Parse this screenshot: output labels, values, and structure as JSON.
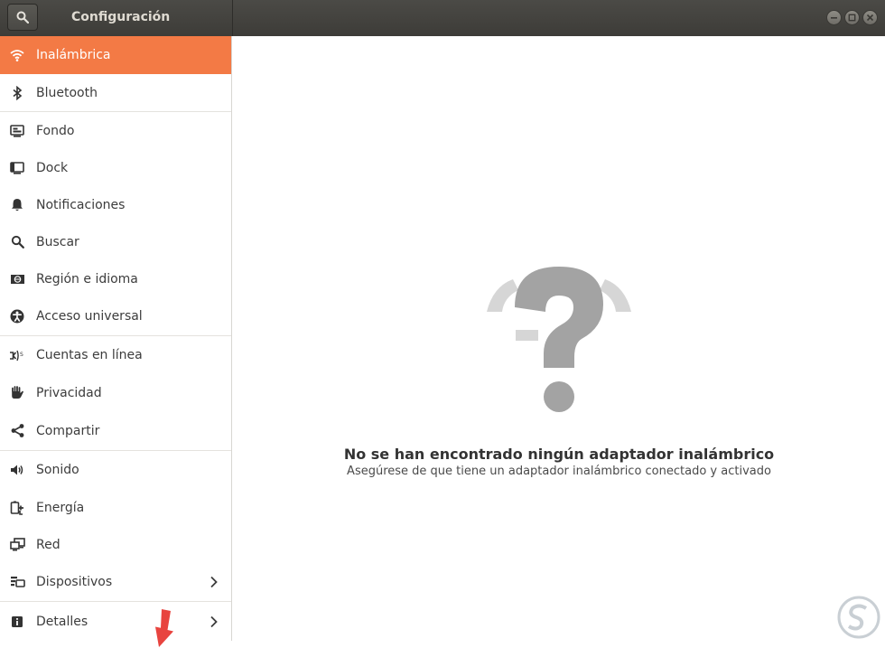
{
  "window": {
    "title": "Configuración"
  },
  "sidebar": {
    "items": [
      {
        "label": "Inalámbrica",
        "icon": "wifi-icon",
        "active": true
      },
      {
        "label": "Bluetooth",
        "icon": "bluetooth-icon"
      },
      {
        "label": "Fondo",
        "icon": "background-icon"
      },
      {
        "label": "Dock",
        "icon": "dock-icon"
      },
      {
        "label": "Notificaciones",
        "icon": "bell-icon"
      },
      {
        "label": "Buscar",
        "icon": "search-icon"
      },
      {
        "label": "Región e idioma",
        "icon": "region-icon"
      },
      {
        "label": "Acceso universal",
        "icon": "accessibility-icon"
      },
      {
        "label": "Cuentas en línea",
        "icon": "online-accounts-icon"
      },
      {
        "label": "Privacidad",
        "icon": "hand-icon"
      },
      {
        "label": "Compartir",
        "icon": "share-icon"
      },
      {
        "label": "Sonido",
        "icon": "speaker-icon"
      },
      {
        "label": "Energía",
        "icon": "power-icon"
      },
      {
        "label": "Red",
        "icon": "network-icon"
      },
      {
        "label": "Dispositivos",
        "icon": "devices-icon",
        "chevron": true
      },
      {
        "label": "Detalles",
        "icon": "info-icon",
        "chevron": true
      }
    ]
  },
  "main": {
    "empty_icon": "question-mark-wifi-icon",
    "title": "No se han encontrado ningún adaptador inalámbrico",
    "subtitle": "Asegúrese de que tiene un adaptador inalámbrico conectado y activado"
  },
  "colors": {
    "accent": "#f37a45",
    "titlebar": "#3f3e3a",
    "icon_gray": "#a3a3a3"
  }
}
